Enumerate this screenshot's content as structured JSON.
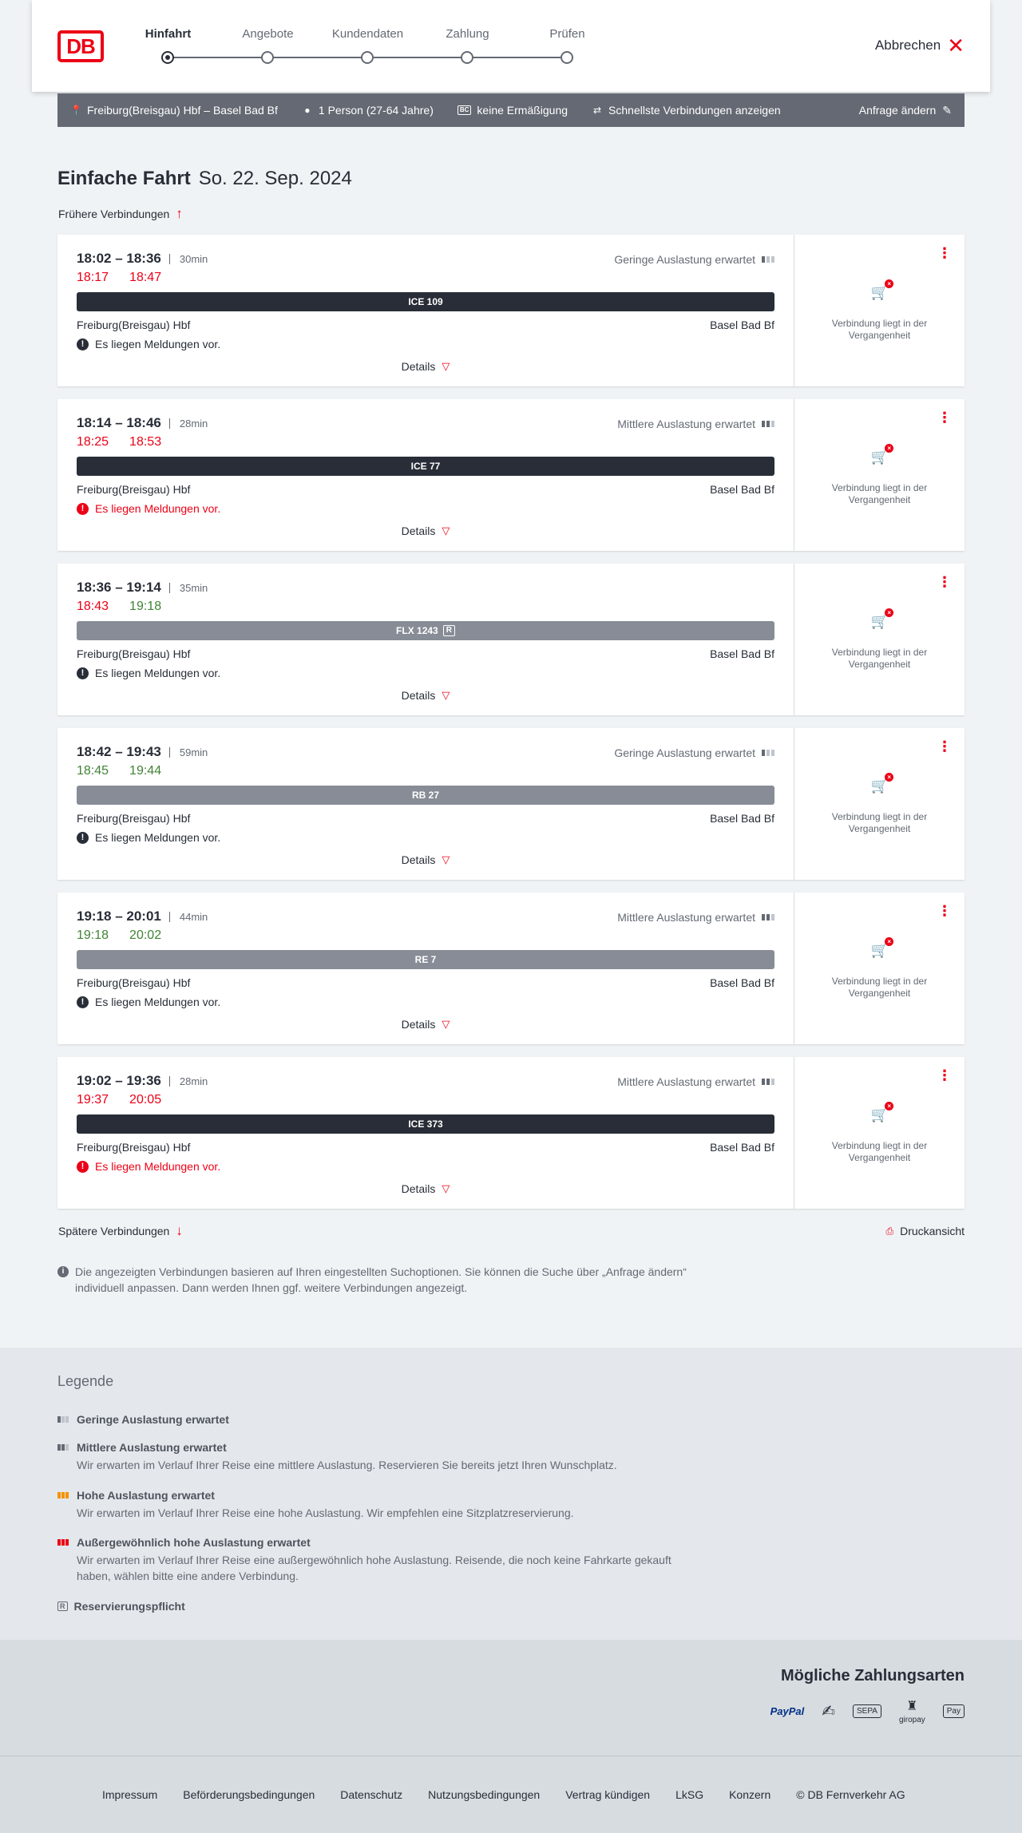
{
  "header": {
    "logo": "DB",
    "steps": [
      "Hinfahrt",
      "Angebote",
      "Kundendaten",
      "Zahlung",
      "Prüfen"
    ],
    "active_step": 0,
    "cancel_label": "Abbrechen"
  },
  "query": {
    "route": "Freiburg(Breisgau) Hbf – Basel Bad Bf",
    "travellers": "1 Person (27-64 Jahre)",
    "discount": "keine Ermäßigung",
    "fastest": "Schnellste Verbindungen anzeigen",
    "change_label": "Anfrage ändern"
  },
  "title": {
    "main": "Einfache Fahrt",
    "date": "So. 22. Sep. 2024"
  },
  "earlier_label": "Frühere Verbindungen",
  "connections": [
    {
      "times": "18:02 – 18:36",
      "duration": "30min",
      "load": "Geringe Auslastung erwartet",
      "load_level": 1,
      "rt_dep": "18:17",
      "rt_arr": "18:47",
      "rt_dep_status": "late",
      "rt_arr_status": "late",
      "train": "ICE 109",
      "train_style": "dark",
      "reservation": false,
      "from": "Freiburg(Breisgau) Hbf",
      "to": "Basel Bad Bf",
      "notice": "Es liegen Meldungen vor.",
      "notice_red": false,
      "details": "Details",
      "past": "Verbindung liegt in der Vergangenheit"
    },
    {
      "times": "18:14 – 18:46",
      "duration": "28min",
      "load": "Mittlere Auslastung erwartet",
      "load_level": 2,
      "rt_dep": "18:25",
      "rt_arr": "18:53",
      "rt_dep_status": "late",
      "rt_arr_status": "late",
      "train": "ICE 77",
      "train_style": "dark",
      "reservation": false,
      "from": "Freiburg(Breisgau) Hbf",
      "to": "Basel Bad Bf",
      "notice": "Es liegen Meldungen vor.",
      "notice_red": true,
      "details": "Details",
      "past": "Verbindung liegt in der Vergangenheit"
    },
    {
      "times": "18:36 – 19:14",
      "duration": "35min",
      "load": "",
      "load_level": 0,
      "rt_dep": "18:43",
      "rt_arr": "19:18",
      "rt_dep_status": "late",
      "rt_arr_status": "ontime",
      "train": "FLX 1243",
      "train_style": "grey",
      "reservation": true,
      "from": "Freiburg(Breisgau) Hbf",
      "to": "Basel Bad Bf",
      "notice": "Es liegen Meldungen vor.",
      "notice_red": false,
      "details": "Details",
      "past": "Verbindung liegt in der Vergangenheit"
    },
    {
      "times": "18:42 – 19:43",
      "duration": "59min",
      "load": "Geringe Auslastung erwartet",
      "load_level": 1,
      "rt_dep": "18:45",
      "rt_arr": "19:44",
      "rt_dep_status": "ontime",
      "rt_arr_status": "ontime",
      "train": "RB 27",
      "train_style": "grey",
      "reservation": false,
      "from": "Freiburg(Breisgau) Hbf",
      "to": "Basel Bad Bf",
      "notice": "Es liegen Meldungen vor.",
      "notice_red": false,
      "details": "Details",
      "past": "Verbindung liegt in der Vergangenheit"
    },
    {
      "times": "19:18 – 20:01",
      "duration": "44min",
      "load": "Mittlere Auslastung erwartet",
      "load_level": 2,
      "rt_dep": "19:18",
      "rt_arr": "20:02",
      "rt_dep_status": "ontime",
      "rt_arr_status": "ontime",
      "train": "RE 7",
      "train_style": "grey",
      "reservation": false,
      "from": "Freiburg(Breisgau) Hbf",
      "to": "Basel Bad Bf",
      "notice": "Es liegen Meldungen vor.",
      "notice_red": false,
      "details": "Details",
      "past": "Verbindung liegt in der Vergangenheit"
    },
    {
      "times": "19:02 – 19:36",
      "duration": "28min",
      "load": "Mittlere Auslastung erwartet",
      "load_level": 2,
      "rt_dep": "19:37",
      "rt_arr": "20:05",
      "rt_dep_status": "late",
      "rt_arr_status": "late",
      "train": "ICE 373",
      "train_style": "dark",
      "reservation": false,
      "from": "Freiburg(Breisgau) Hbf",
      "to": "Basel Bad Bf",
      "notice": "Es liegen Meldungen vor.",
      "notice_red": true,
      "details": "Details",
      "past": "Verbindung liegt in der Vergangenheit"
    }
  ],
  "later_label": "Spätere Verbindungen",
  "print_label": "Druckansicht",
  "info_text": "Die angezeigten Verbindungen basieren auf Ihren eingestellten Suchoptionen. Sie können die Suche über „Anfrage ändern“ individuell anpassen. Dann werden Ihnen ggf. weitere Verbindungen angezeigt.",
  "legend": {
    "title": "Legende",
    "items": [
      {
        "head": "Geringe Auslastung erwartet",
        "desc": ""
      },
      {
        "head": "Mittlere Auslastung erwartet",
        "desc": "Wir erwarten im Verlauf Ihrer Reise eine mittlere Auslastung. Reservieren Sie bereits jetzt Ihren Wunschplatz."
      },
      {
        "head": "Hohe Auslastung erwartet",
        "desc": "Wir erwarten im Verlauf Ihrer Reise eine hohe Auslastung. Wir empfehlen eine Sitzplatzreservierung."
      },
      {
        "head": "Außergewöhnlich hohe Auslastung erwartet",
        "desc": "Wir erwarten im Verlauf Ihrer Reise eine außergewöhnlich hohe Auslastung. Reisende, die noch keine Fahrkarte gekauft haben, wählen bitte eine andere Verbindung."
      },
      {
        "head": "Reservierungspflicht",
        "desc": ""
      }
    ]
  },
  "payment": {
    "title": "Mögliche Zahlungsarten",
    "methods": [
      "PayPal",
      "Kreditkarte",
      "SEPA",
      "giropay",
      "Apple Pay"
    ]
  },
  "footer": {
    "links": [
      "Impressum",
      "Beförderungsbedingungen",
      "Datenschutz",
      "Nutzungsbedingungen",
      "Vertrag kündigen",
      "LkSG",
      "Konzern",
      "© DB Fernverkehr AG"
    ]
  },
  "colors": {
    "brand": "#ec0016",
    "late": "#ec0016",
    "ontime": "#408335",
    "dark_bar": "#282d37",
    "grey_bar": "#878c96"
  }
}
